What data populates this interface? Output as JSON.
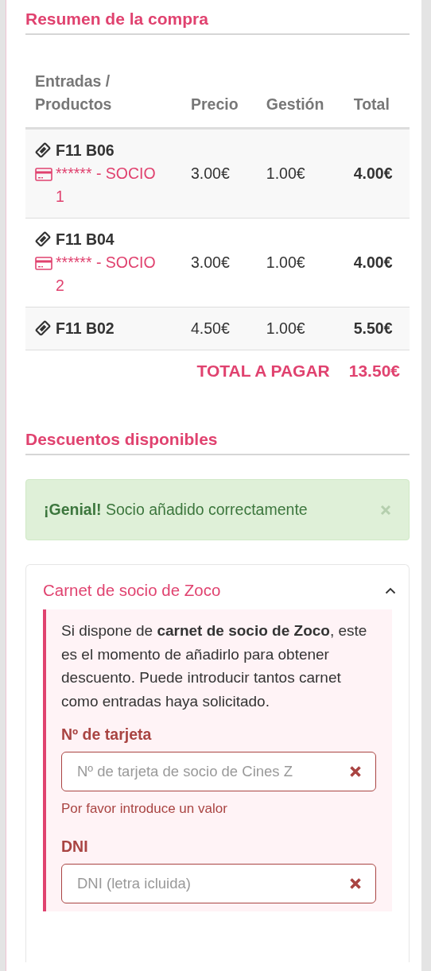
{
  "summary": {
    "title": "Resumen de la compra",
    "columns": [
      "Entradas / Productos",
      "Precio",
      "Gestión",
      "Total"
    ],
    "rows": [
      {
        "seat": "F11 B06",
        "member": "****** - SOCIO 1",
        "price": "3.00€",
        "fee": "1.00€",
        "total": "4.00€"
      },
      {
        "seat": "F11 B04",
        "member": "****** - SOCIO 2",
        "price": "3.00€",
        "fee": "1.00€",
        "total": "4.00€"
      },
      {
        "seat": "F11 B02",
        "price": "4.50€",
        "fee": "1.00€",
        "total": "5.50€"
      }
    ],
    "total_label": "TOTAL A PAGAR",
    "total_value": "13.50€"
  },
  "discounts": {
    "title": "Descuentos disponibles",
    "alert": {
      "text": "**¡Genial!** Socio añadido correctamente"
    },
    "card": {
      "title": "Carnet de socio de Zoco",
      "expanded": true,
      "description": "Si dispone de **carnet de socio de Zoco**, este es el momento de añadirlo para obtener descuento. Puede introducir tantos carnet como entradas haya solicitado.",
      "fields": [
        {
          "label": "Nº de tarjeta",
          "placeholder": "Nº de tarjeta de socio de Cines Z",
          "invalid": true,
          "error": "Por favor introduce un valor"
        },
        {
          "label": "DNI",
          "placeholder": "DNI (letra icluida)",
          "invalid": true
        }
      ]
    }
  }
}
